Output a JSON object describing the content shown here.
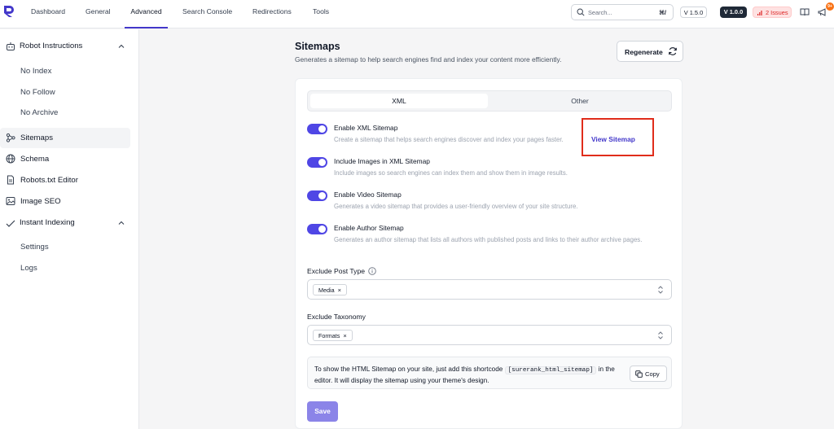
{
  "topbar": {
    "nav": [
      "Dashboard",
      "General",
      "Advanced",
      "Search Console",
      "Redirections",
      "Tools"
    ],
    "active_nav": "Advanced",
    "search_placeholder": "Search...",
    "search_shortcut": "⌘/",
    "version_pill": "V 1.5.0",
    "pro_version_pill": "V 1.0.0",
    "issues": "2 Issues",
    "notification_badge": "9+",
    "accent_color": "#4338ca"
  },
  "sidebar": {
    "robot_instructions": {
      "label": "Robot Instructions",
      "items": [
        "No Index",
        "No Follow",
        "No Archive"
      ]
    },
    "sitemaps": "Sitemaps",
    "schema": "Schema",
    "robots_editor": "Robots.txt Editor",
    "image_seo": "Image SEO",
    "instant_indexing": {
      "label": "Instant Indexing",
      "items": [
        "Settings",
        "Logs"
      ]
    },
    "active_item": "Sitemaps"
  },
  "main": {
    "title": "Sitemaps",
    "description": "Generates a sitemap to help search engines find and index your content more efficiently.",
    "regenerate": "Regenerate",
    "tabs": [
      "XML",
      "Other"
    ],
    "active_tab": "XML",
    "toggles": [
      {
        "title": "Enable XML Sitemap",
        "desc": "Create a sitemap that helps search engines discover and index your pages faster.",
        "on": true
      },
      {
        "title": "Include Images in XML Sitemap",
        "desc": "Include images so search engines can index them and show them in image results.",
        "on": true
      },
      {
        "title": "Enable Video Sitemap",
        "desc": "Generates a video sitemap that provides a user-friendly overview of your site structure.",
        "on": true
      },
      {
        "title": "Enable Author Sitemap",
        "desc": "Generates an author sitemap that lists all authors with published posts and links to their author archive pages.",
        "on": true
      }
    ],
    "view_sitemap": "View Sitemap",
    "exclude_post_type": {
      "label": "Exclude Post Type",
      "chips": [
        "Media"
      ]
    },
    "exclude_taxonomy": {
      "label": "Exclude Taxonomy",
      "chips": [
        "Formats"
      ]
    },
    "shortcode": {
      "text_before": "To show the HTML Sitemap on your site, just add this shortcode",
      "code": "[surerank_html_sitemap]",
      "text_after": "in the editor. It will display the sitemap using your theme's design."
    },
    "copy": "Copy",
    "save": "Save",
    "highlight_color": "#e02d1b"
  }
}
